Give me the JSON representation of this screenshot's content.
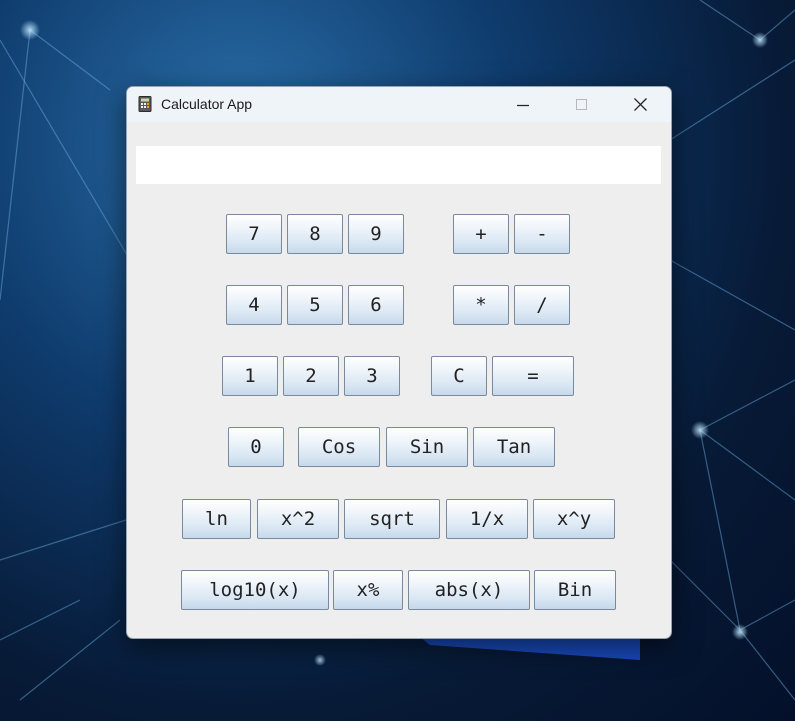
{
  "window": {
    "title": "Calculator App",
    "display_value": ""
  },
  "icons": {
    "app": "calculator-icon",
    "minimize": "minimize-icon",
    "maximize": "maximize-icon",
    "close": "close-icon"
  },
  "colors": {
    "window_bg": "#eeeeee",
    "titlebar_bg": "#eff4f9",
    "button_top": "#ffffff",
    "button_bottom": "#c6d8ea",
    "button_border": "#7a8a9e"
  },
  "buttons": {
    "7": "7",
    "8": "8",
    "9": "9",
    "plus": "+",
    "minus": "-",
    "4": "4",
    "5": "5",
    "6": "6",
    "multiply": "*",
    "divide": "/",
    "1": "1",
    "2": "2",
    "3": "3",
    "clear": "C",
    "equals": "=",
    "0": "0",
    "cos": "Cos",
    "sin": "Sin",
    "tan": "Tan",
    "ln": "ln",
    "square": "x^2",
    "sqrt": "sqrt",
    "reciprocal": "1/x",
    "power": "x^y",
    "log10": "log10(x)",
    "percent": "x%",
    "abs": "abs(x)",
    "bin": "Bin"
  }
}
